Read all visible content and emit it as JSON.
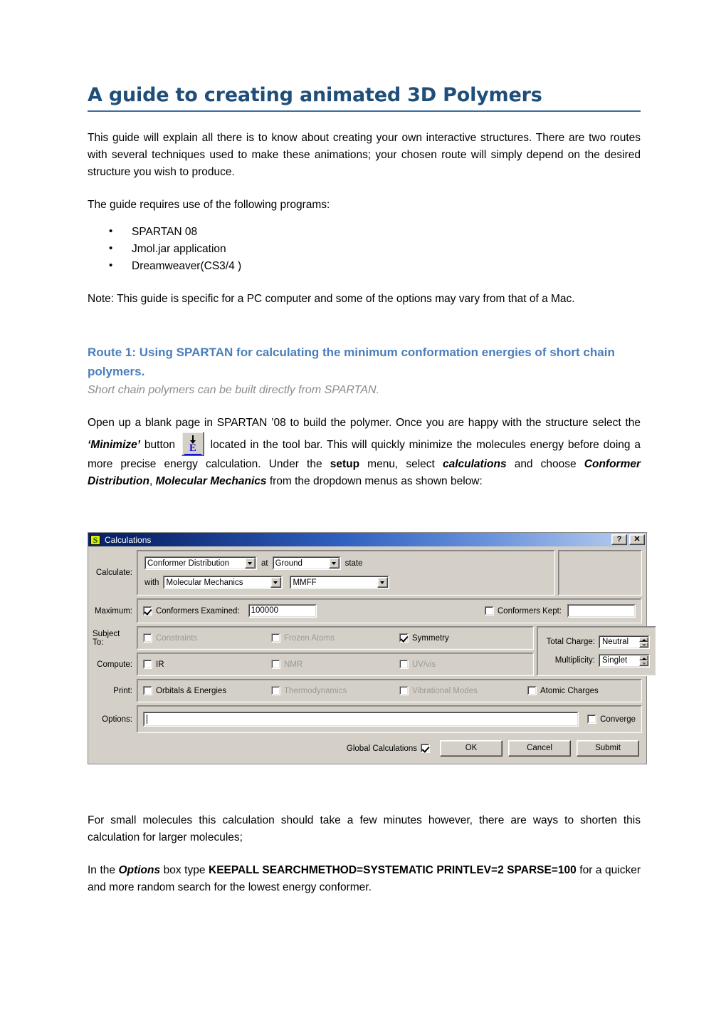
{
  "document": {
    "title": "A guide to creating animated 3D Polymers",
    "intro_paragraph": "This guide will explain all there is to know about creating your own interactive structures. There are two routes with several techniques used to make these animations; your chosen route will simply depend on the desired structure you wish to produce.",
    "requires_line": "The guide requires use of the following programs:",
    "programs": [
      "SPARTAN 08",
      "Jmol.jar application",
      "Dreamweaver(CS3/4 )"
    ],
    "note_paragraph": "Note: This guide is specific for a PC computer and some of the options may vary from that of a Mac.",
    "route_heading": "Route 1: Using SPARTAN for calculating the minimum conformation energies of short chain polymers.",
    "route_subtitle": "Short chain polymers can be built directly from SPARTAN.",
    "steps_paragraph": {
      "part1": "Open up a blank page in SPARTAN ’08 to build the polymer. Once you are happy with the structure select the ",
      "minimize_emph": "‘Minimize’",
      "part2": " button ",
      "part3": " located in the tool bar. This will quickly minimize the molecules energy before doing a more precise energy calculation. Under the ",
      "setup_emph": "setup",
      "part4": " menu, select ",
      "calculations_emph": "calculations",
      "part5": " and choose ",
      "conformer_emph": "Conformer Distribution",
      "part6": ", ",
      "mechanics_emph": "Molecular Mechanics",
      "part7": " from the dropdown menus as shown below:"
    },
    "after_dialog_paragraph": "For small molecules this calculation should take a few minutes however, there are ways to shorten this calculation for larger molecules;",
    "options_paragraph": {
      "part1": "In the ",
      "options_emph": "Options",
      "part2": " box type ",
      "command": "KEEPALL SEARCHMETHOD=SYSTEMATIC PRINTLEV=2 SPARSE=100",
      "part3": " for a quicker and more random search for the lowest energy conformer."
    },
    "minimize_icon_letter": "E",
    "colors": {
      "title": "#1F4E79",
      "route_heading": "#4A7EBB",
      "rule": "#3B6EA5",
      "subtitle": "#8C8C8C"
    }
  },
  "dialog": {
    "titlebar": {
      "app_icon_letter": "S",
      "title": "Calculations",
      "help_button": "?",
      "close_button": "✕"
    },
    "calculate": {
      "label": "Calculate:",
      "task": "Conformer Distribution",
      "at_label": "at",
      "state": "Ground",
      "state_label": "state",
      "with_label": "with",
      "method": "Molecular Mechanics",
      "forcefield": "MMFF"
    },
    "maximum": {
      "label": "Maximum:",
      "conformers_examined_label": "Conformers Examined:",
      "conformers_examined_checked": true,
      "conformers_examined_value": "100000",
      "conformers_kept_label": "Conformers Kept:",
      "conformers_kept_checked": false,
      "conformers_kept_value": ""
    },
    "subject_to": {
      "label": "Subject To:",
      "items": [
        {
          "label": "Constraints",
          "checked": false,
          "enabled": false
        },
        {
          "label": "Frozen Atoms",
          "checked": false,
          "enabled": false
        },
        {
          "label": "Symmetry",
          "checked": true,
          "enabled": true
        }
      ]
    },
    "compute": {
      "label": "Compute:",
      "items": [
        {
          "label": "IR",
          "checked": false,
          "enabled": true
        },
        {
          "label": "NMR",
          "checked": false,
          "enabled": false
        },
        {
          "label": "UV/vis",
          "checked": false,
          "enabled": false
        }
      ]
    },
    "print": {
      "label": "Print:",
      "items": [
        {
          "label": "Orbitals & Energies",
          "checked": false,
          "enabled": true
        },
        {
          "label": "Thermodynamics",
          "checked": false,
          "enabled": false
        },
        {
          "label": "Vibrational Modes",
          "checked": false,
          "enabled": false
        },
        {
          "label": "Atomic Charges",
          "checked": false,
          "enabled": true
        }
      ]
    },
    "charge": {
      "total_charge_label": "Total Charge:",
      "total_charge_value": "Neutral",
      "multiplicity_label": "Multiplicity:",
      "multiplicity_value": "Singlet"
    },
    "options": {
      "label": "Options:",
      "value": "",
      "converge_label": "Converge",
      "converge_checked": false
    },
    "footer": {
      "global_calculations_label": "Global Calculations",
      "global_calculations_checked": true,
      "ok_label": "OK",
      "cancel_label": "Cancel",
      "submit_label": "Submit"
    }
  }
}
